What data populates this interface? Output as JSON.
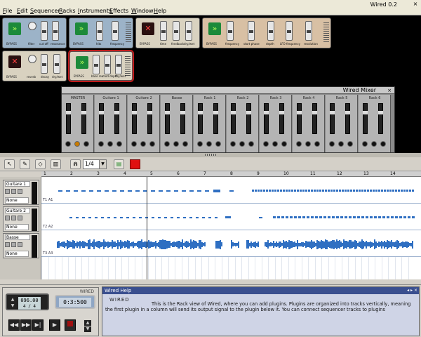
{
  "window": {
    "title": "Wired 0.2",
    "close": "×"
  },
  "menubar": {
    "items": [
      "File",
      "Edit",
      "Sequencer",
      "Racks",
      "Instruments",
      "Effects",
      "Window",
      "Help"
    ]
  },
  "rack": {
    "bypass_label": "BYPASS",
    "plugins": [
      {
        "labels": [
          "filter",
          "cut off",
          "resonance"
        ]
      },
      {
        "labels": [
          "hits",
          "frequency"
        ]
      },
      {
        "labels": [
          "time",
          "feedback",
          "dry/wet"
        ]
      },
      {
        "labels": [
          "frequency",
          "start phase",
          "depth",
          "LFO frequency",
          "resolution"
        ]
      },
      {
        "labels": [
          "reverb",
          "decay",
          "dry/wet"
        ]
      },
      {
        "labels": [
          "base rev",
          "mod depth",
          "dry/wet"
        ]
      }
    ]
  },
  "mixer": {
    "title": "Wired Mixer",
    "close": "×",
    "channels": [
      "MASTER",
      "Guitare 1",
      "Guitare 2",
      "Basse",
      "Rack 1",
      "Rack 2",
      "Rack 3",
      "Rack 4",
      "Rack 5",
      "Rack 6"
    ]
  },
  "toolbar": {
    "tools": [
      {
        "name": "pointer-tool",
        "glyph": "↖"
      },
      {
        "name": "pencil-tool",
        "glyph": "✎"
      },
      {
        "name": "eraser-tool",
        "glyph": "◇"
      },
      {
        "name": "split-tool",
        "glyph": "▥"
      }
    ],
    "magnet": "⋒",
    "quantize": "1/4",
    "quantize_arrow": "▼",
    "snap_glyph": "▤"
  },
  "ruler": {
    "marks": [
      "1",
      "2",
      "3",
      "4",
      "5",
      "6",
      "7",
      "8",
      "9",
      "10",
      "11",
      "12",
      "13",
      "14"
    ]
  },
  "tracks": [
    {
      "name": "Guitare 1",
      "device": "None",
      "tag": "T1 A1"
    },
    {
      "name": "Guitare 2",
      "device": "None",
      "tag": "T2 A2"
    },
    {
      "name": "Basse",
      "device": "None",
      "tag": "T3 A3"
    }
  ],
  "transport": {
    "logo": "WIRED",
    "bpm": "096.00",
    "signature": "4 / 4",
    "time": "0:3:500",
    "buttons": {
      "rewind": "◀◀",
      "forward": "▶▶",
      "loop": "▶|",
      "play": "▶",
      "up": "▲",
      "down": "▼"
    }
  },
  "help": {
    "title": "Wired Help",
    "controls": "◂ ▸ ×",
    "logo": "WIRED",
    "text": "This is the Rack view of Wired, where you can add plugins. Plugins are organized into tracks vertically, meaning the first plugin in a column will send its output signal to the plugin below it. You can connect sequencer tracks to plugins"
  }
}
